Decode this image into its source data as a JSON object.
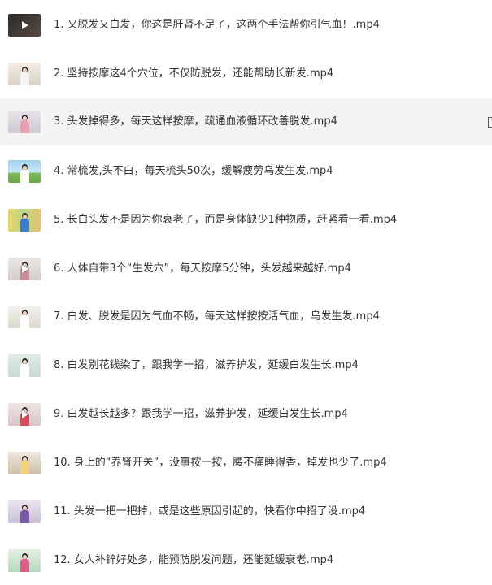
{
  "files": [
    {
      "name": "1. 又脱发又白发，你这是肝肾不足了，这两个手法帮你引气血！.mp4",
      "thumbnail": "video-thumbnail",
      "selected": false
    },
    {
      "name": "2. 坚持按摩这4个穴位，不仅防脱发，还能帮助长新发.mp4",
      "thumbnail": "video-thumbnail",
      "selected": false
    },
    {
      "name": "3. 头发掉得多，每天这样按摩，疏通血液循环改善脱发.mp4",
      "thumbnail": "video-thumbnail",
      "selected": true
    },
    {
      "name": "4. 常梳发,头不白，每天梳头50次，缓解疲劳乌发生发.mp4",
      "thumbnail": "video-thumbnail",
      "selected": false
    },
    {
      "name": "5. 长白头发不是因为你衰老了，而是身体缺少1种物质，赶紧看一看.mp4",
      "thumbnail": "video-thumbnail",
      "selected": false
    },
    {
      "name": "6. 人体自带3个“生发穴”，每天按摩5分钟，头发越来越好.mp4",
      "thumbnail": "video-thumbnail",
      "selected": false
    },
    {
      "name": "7. 白发、脱发是因为气血不畅，每天这样按按活气血，乌发生发.mp4",
      "thumbnail": "video-thumbnail",
      "selected": false
    },
    {
      "name": "8. 白发别花钱染了，跟我学一招，滋养护发，延缓白发生长.mp4",
      "thumbnail": "video-thumbnail",
      "selected": false
    },
    {
      "name": "9. 白发越长越多？跟我学一招，滋养护发，延缓白发生长.mp4",
      "thumbnail": "video-thumbnail",
      "selected": false
    },
    {
      "name": "10. 身上的“养肾开关”，没事按一按，腰不痛睡得香，掉发也少了.mp4",
      "thumbnail": "video-thumbnail",
      "selected": false
    },
    {
      "name": "11. 头发一把一把掉，或是这些原因引起的，快看你中招了没.mp4",
      "thumbnail": "video-thumbnail",
      "selected": false
    },
    {
      "name": "12. 女人补锌好处多，能预防脱发问题，还能延缓衰老.mp4",
      "thumbnail": "video-thumbnail",
      "selected": false
    }
  ],
  "colors": {
    "text": "#333333",
    "selected_row": "#f4f4f4",
    "background": "#ffffff"
  }
}
